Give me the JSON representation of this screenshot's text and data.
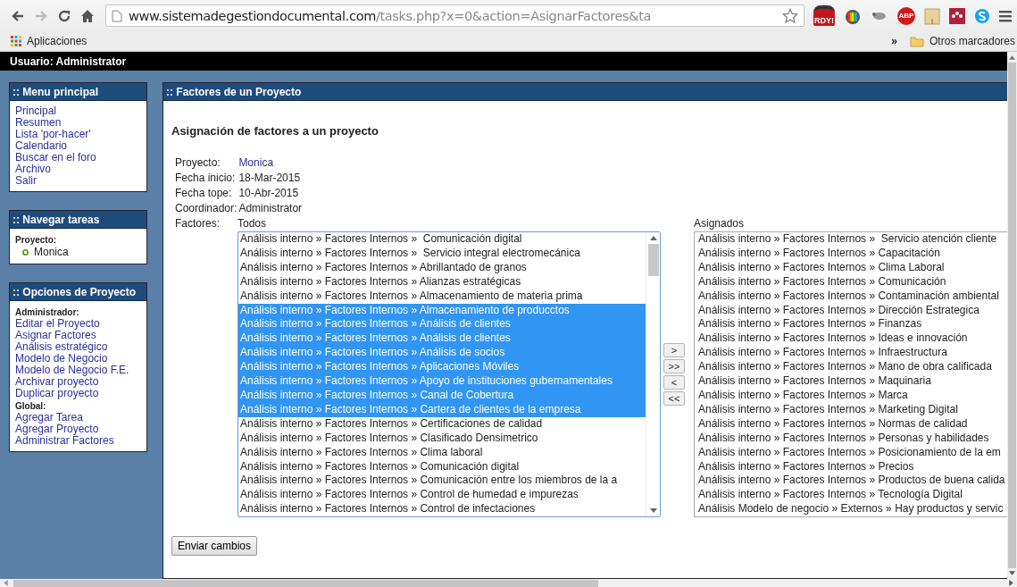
{
  "browser": {
    "url_host": "www.sistemadegestiondocumental.com",
    "url_path": "/tasks.php?x=0&action=AsignarFactores&ta",
    "extensions": [
      {
        "kind": "badge",
        "label": "RDY!"
      },
      {
        "kind": "tv"
      },
      {
        "kind": "mouse"
      },
      {
        "kind": "stop",
        "label": "ABP"
      },
      {
        "kind": "box"
      },
      {
        "kind": "dots"
      },
      {
        "kind": "skype"
      }
    ],
    "bookmarks": {
      "apps": "Aplicaciones",
      "more": "»",
      "other": "Otros marcadores"
    }
  },
  "user_bar": "Usuario: Administrator",
  "sidebar": [
    {
      "title": ":: Menu principal",
      "sections": [
        {
          "links": [
            "Principal",
            "Resumen",
            "Lista 'por-hacer'",
            "Calendario",
            "Buscar en el foro",
            "Archivo",
            "Salir"
          ]
        }
      ]
    },
    {
      "title": ":: Navegar tareas",
      "sections": [
        {
          "heading": "Proyecto:",
          "bullets": [
            "Monica"
          ]
        }
      ]
    },
    {
      "title": ":: Opciones de Proyecto",
      "sections": [
        {
          "heading": "Administrador:",
          "links": [
            "Editar el Proyecto",
            "Asignar Factores",
            "Análisis estratégico",
            "Modelo de Negocio",
            "Modelo de Negocio F.E.",
            "Archivar proyecto",
            "Duplicar proyecto"
          ]
        },
        {
          "heading": "Global:",
          "links": [
            "Agregar Tarea",
            "Agregar Proyecto",
            "Administrar Factores"
          ]
        }
      ]
    }
  ],
  "main": {
    "title": ":: Factores de un Proyecto",
    "heading": "Asignación de factores a un proyecto",
    "info": [
      {
        "label": "Proyecto:",
        "value": "Monica",
        "kind": "link"
      },
      {
        "label": "Fecha inicio:",
        "value": "18-Mar-2015",
        "kind": "text"
      },
      {
        "label": "Fecha tope:",
        "value": "10-Abr-2015",
        "kind": "text"
      },
      {
        "label": "Coordinador:",
        "value": "Administrator",
        "kind": "text"
      }
    ],
    "factores_label": "Factores:",
    "all_label": "Todos",
    "assigned_label": "Asignados",
    "all": [
      {
        "text": "Análisis interno » Factores Internos »  Comunicación digital",
        "selected": false
      },
      {
        "text": "Análisis interno » Factores Internos »  Servicio integral electromecánica",
        "selected": false
      },
      {
        "text": "Análisis interno » Factores Internos » Abrillantado de granos",
        "selected": false
      },
      {
        "text": "Análisis interno » Factores Internos » Alianzas estratégicas",
        "selected": false
      },
      {
        "text": "Análisis interno » Factores Internos » Almacenamiento de materia prima",
        "selected": false
      },
      {
        "text": "Análisis interno » Factores Internos » Almacenamiento de producctos",
        "selected": true
      },
      {
        "text": "Análisis interno » Factores Internos » Análisis de clientes",
        "selected": true
      },
      {
        "text": "Análisis interno » Factores Internos » Análisis de clientes",
        "selected": true
      },
      {
        "text": "Análisis interno » Factores Internos » Análisis de socios",
        "selected": true
      },
      {
        "text": "Análisis interno » Factores Internos » Aplicaciones Móviles",
        "selected": true
      },
      {
        "text": "Análisis interno » Factores Internos » Apoyo de instituciones gubernamentales",
        "selected": true
      },
      {
        "text": "Análisis interno » Factores Internos » Canal de Cobertura",
        "selected": true
      },
      {
        "text": "Análisis interno » Factores Internos » Cartera de clientes de la empresa",
        "selected": true
      },
      {
        "text": "Análisis interno » Factores Internos » Certificaciones de calidad",
        "selected": false
      },
      {
        "text": "Análisis interno » Factores Internos » Clasificado Densimetrico",
        "selected": false
      },
      {
        "text": "Análisis interno » Factores Internos » Clima laboral",
        "selected": false
      },
      {
        "text": "Análisis interno » Factores Internos » Comunicación digital",
        "selected": false
      },
      {
        "text": "Análisis interno » Factores Internos » Comunicación entre los miembros de la a",
        "selected": false
      },
      {
        "text": "Análisis interno » Factores Internos » Control de humedad e impurezas",
        "selected": false
      },
      {
        "text": "Análisis interno » Factores Internos » Control de infectaciones",
        "selected": false
      }
    ],
    "move_buttons": [
      ">",
      ">>",
      "<",
      "<<"
    ],
    "assigned": [
      "Análisis interno » Factores Internos »  Servicio atención cliente",
      "Análisis interno » Factores Internos » Capacitación",
      "Análisis interno » Factores Internos » Clima Laboral",
      "Análisis interno » Factores Internos » Comunicación",
      "Análisis interno » Factores Internos » Contaminación ambiental",
      "Análisis interno » Factores Internos » Dirección Estrategica",
      "Análisis interno » Factores Internos » Finanzas",
      "Análisis interno » Factores Internos » Ideas e innovación",
      "Análisis interno » Factores Internos » Infraestructura",
      "Análisis interno » Factores Internos » Mano de obra calificada",
      "Análisis interno » Factores Internos » Maquinaria",
      "Análisis interno » Factores Internos » Marca",
      "Análisis interno » Factores Internos » Marketing Digital",
      "Análisis interno » Factores Internos » Normas de calidad",
      "Análisis interno » Factores Internos » Personas y habilidades",
      "Análisis interno » Factores Internos » Posicionamiento de la em",
      "Análisis interno » Factores Internos » Precios",
      "Análisis interno » Factores Internos » Productos de buena calida",
      "Análisis interno » Factores Internos » Tecnología Digital",
      "Análisis Modelo de negocio » Externos » Hay productos y servic"
    ],
    "submit": "Enviar cambios"
  }
}
